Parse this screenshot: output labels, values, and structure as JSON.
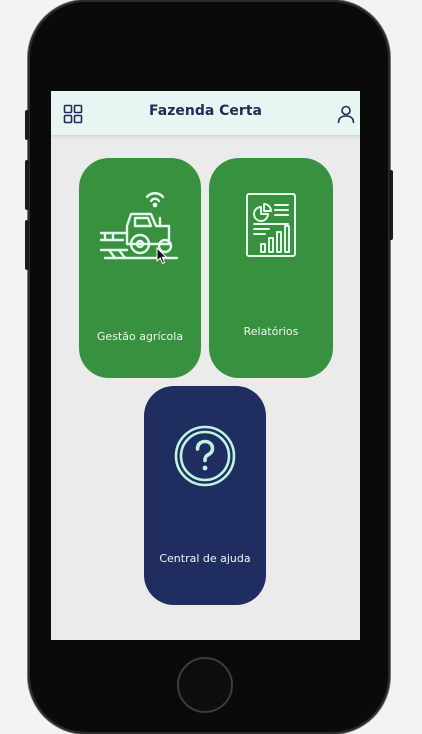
{
  "app": {
    "title": "Fazenda Certa"
  },
  "header": {
    "menu_icon": "grid-icon",
    "profile_icon": "user-icon"
  },
  "cards": [
    {
      "label": "Gestão agrícola",
      "icon": "tractor-wifi-icon",
      "color": "#37913e"
    },
    {
      "label": "Relatórios",
      "icon": "report-chart-icon",
      "color": "#37913e"
    },
    {
      "label": "Central de ajuda",
      "icon": "help-circle-icon",
      "color": "#1f2d61"
    }
  ],
  "colors": {
    "header_bg": "#e8f6f3",
    "title": "#1f2d55",
    "icon_accent": "#bff5de"
  }
}
